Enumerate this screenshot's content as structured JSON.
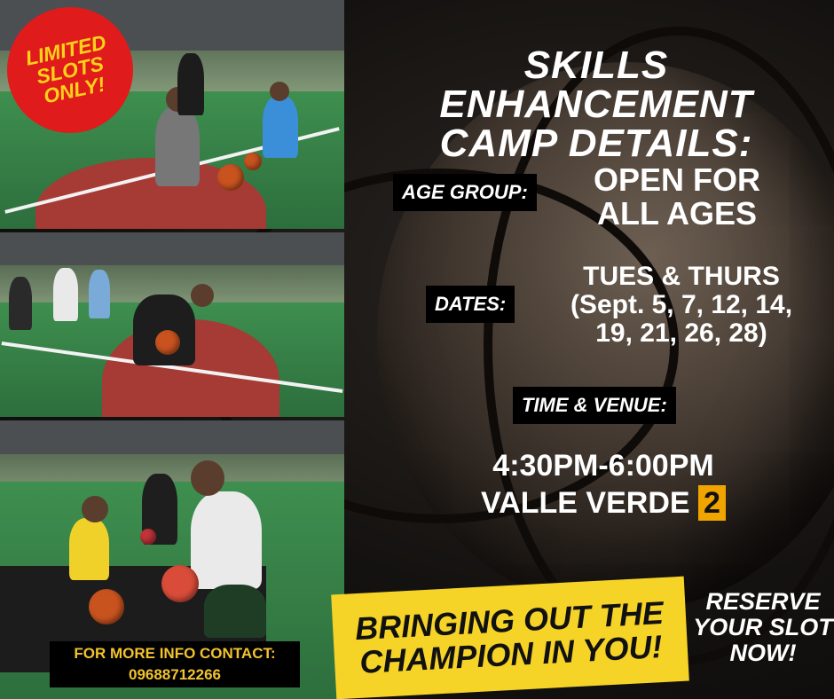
{
  "badge": {
    "line1": "LIMITED",
    "line2": "SLOTS",
    "line3": "ONLY!"
  },
  "title": {
    "line1": "SKILLS ENHANCEMENT",
    "line2": "CAMP DETAILS:"
  },
  "age": {
    "label": "AGE GROUP:",
    "value_line1": "OPEN FOR",
    "value_line2": "ALL AGES"
  },
  "dates": {
    "label": "DATES:",
    "line1": "TUES & THURS",
    "line2": "(Sept. 5, 7, 12, 14,",
    "line3": "19, 21, 26, 28)"
  },
  "time_venue": {
    "label": "TIME & VENUE:",
    "time": "4:30PM-6:00PM",
    "venue": "VALLE VERDE",
    "venue_number": "2"
  },
  "contact": {
    "label": "FOR MORE INFO CONTACT:",
    "phone": "09688712266"
  },
  "banner": {
    "line1": "BRINGING OUT THE",
    "line2": "CHAMPION IN YOU!"
  },
  "cta": {
    "line1": "RESERVE",
    "line2": "YOUR SLOT",
    "line3": "NOW!"
  },
  "colors": {
    "badge_red": "#e01b1b",
    "badge_text": "#ffd21a",
    "banner_yellow": "#f6d327",
    "accent_orange": "#f0a400",
    "contact_text": "#f2c22f"
  }
}
